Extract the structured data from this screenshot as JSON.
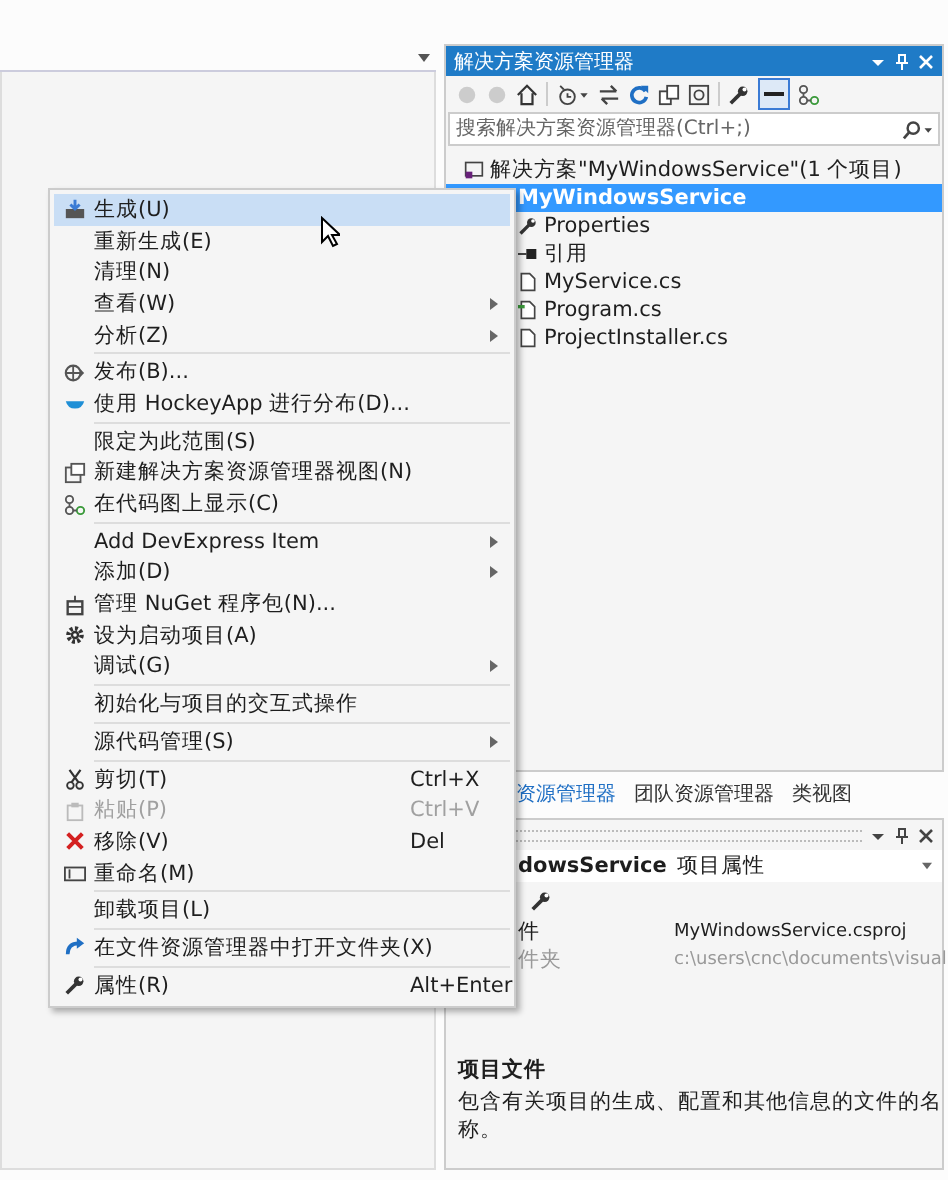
{
  "solution_explorer": {
    "title": "解决方案资源管理器",
    "search": {
      "placeholder": "搜索解决方案资源管理器(Ctrl+;)"
    },
    "tree": [
      {
        "label": "解决方案\"MyWindowsService\"(1 个项目)",
        "kind": "solution",
        "selected": false,
        "children": [
          {
            "label": "MyWindowsService",
            "kind": "project",
            "selected": true,
            "children": [
              {
                "label": "Properties",
                "kind": "properties",
                "selected": false
              },
              {
                "label": "引用",
                "kind": "references",
                "selected": false
              },
              {
                "label": "MyService.cs",
                "kind": "file",
                "selected": false
              },
              {
                "label": "Program.cs",
                "kind": "code",
                "selected": false
              },
              {
                "label": "ProjectInstaller.cs",
                "kind": "file",
                "selected": false
              }
            ]
          }
        ]
      }
    ]
  },
  "tabs": [
    {
      "label": "资源管理器",
      "selected": true
    },
    {
      "label": "团队资源管理器",
      "selected": false
    },
    {
      "label": "类视图",
      "selected": false
    }
  ],
  "properties": {
    "header": {
      "name": "dowsService",
      "type": "项目属性"
    },
    "rows": [
      {
        "name": "件",
        "value": "MyWindowsService.csproj",
        "disabled": false
      },
      {
        "name": "件夹",
        "value": "c:\\users\\cnc\\documents\\visual",
        "disabled": true
      }
    ],
    "description": {
      "title": "项目文件",
      "text": "包含有关项目的生成、配置和其他信息的文件的名称。"
    }
  },
  "context_menu": {
    "groups": [
      [
        {
          "label": "生成(U)",
          "selected": true,
          "disabled": false,
          "submenu": false
        },
        {
          "label": "重新生成(E)",
          "selected": false,
          "disabled": false,
          "submenu": false
        },
        {
          "label": "清理(N)",
          "selected": false,
          "disabled": false,
          "submenu": false
        },
        {
          "label": "查看(W)",
          "selected": false,
          "disabled": false,
          "submenu": true
        },
        {
          "label": "分析(Z)",
          "selected": false,
          "disabled": false,
          "submenu": true
        }
      ],
      [
        {
          "label": "发布(B)...",
          "selected": false,
          "disabled": false,
          "submenu": false
        },
        {
          "label": "使用 HockeyApp 进行分布(D)...",
          "selected": false,
          "disabled": false,
          "submenu": false
        }
      ],
      [
        {
          "label": "限定为此范围(S)",
          "selected": false,
          "disabled": false,
          "submenu": false
        },
        {
          "label": "新建解决方案资源管理器视图(N)",
          "selected": false,
          "disabled": false,
          "submenu": false
        },
        {
          "label": "在代码图上显示(C)",
          "selected": false,
          "disabled": false,
          "submenu": false
        }
      ],
      [
        {
          "label": "Add DevExpress Item",
          "selected": false,
          "disabled": false,
          "submenu": true
        },
        {
          "label": "添加(D)",
          "selected": false,
          "disabled": false,
          "submenu": true
        },
        {
          "label": "管理 NuGet 程序包(N)...",
          "selected": false,
          "disabled": false,
          "submenu": false
        },
        {
          "label": "设为启动项目(A)",
          "selected": false,
          "disabled": false,
          "submenu": false
        },
        {
          "label": "调试(G)",
          "selected": false,
          "disabled": false,
          "submenu": true
        }
      ],
      [
        {
          "label": "初始化与项目的交互式操作",
          "selected": false,
          "disabled": false,
          "submenu": false
        }
      ],
      [
        {
          "label": "源代码管理(S)",
          "selected": false,
          "disabled": false,
          "submenu": true
        }
      ],
      [
        {
          "label": "剪切(T)",
          "shortcut": "Ctrl+X",
          "selected": false,
          "disabled": false,
          "submenu": false
        },
        {
          "label": "粘贴(P)",
          "shortcut": "Ctrl+V",
          "selected": false,
          "disabled": true,
          "submenu": false
        },
        {
          "label": "移除(V)",
          "shortcut": "Del",
          "selected": false,
          "disabled": false,
          "submenu": false
        },
        {
          "label": "重命名(M)",
          "selected": false,
          "disabled": false,
          "submenu": false
        }
      ],
      [
        {
          "label": "卸载项目(L)",
          "selected": false,
          "disabled": false,
          "submenu": false
        }
      ],
      [
        {
          "label": "在文件资源管理器中打开文件夹(X)",
          "selected": false,
          "disabled": false,
          "submenu": false
        }
      ],
      [
        {
          "label": "属性(R)",
          "shortcut": "Alt+Enter",
          "selected": false,
          "disabled": false,
          "submenu": false
        }
      ]
    ]
  }
}
